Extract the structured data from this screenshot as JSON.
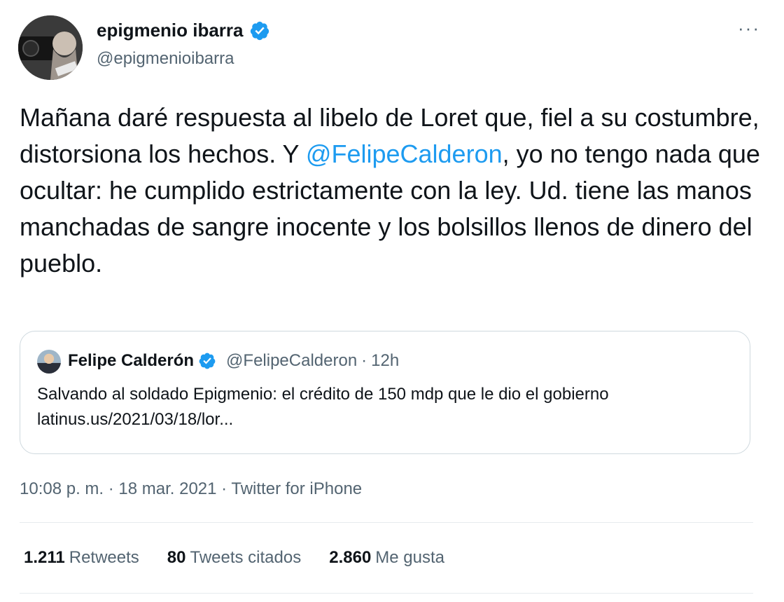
{
  "author": {
    "display_name": "epigmenio ibarra",
    "handle": "@epigmenioibarra",
    "verified_icon": "verified-badge-icon"
  },
  "more_label": "···",
  "tweet": {
    "text_before": "Mañana daré respuesta al libelo de Loret que, fiel a su costumbre, distorsiona los hechos. Y ",
    "mention": "@FelipeCalderon",
    "text_after": ", yo no tengo nada que ocultar: he cumplido estrictamente con la ley. Ud. tiene las manos manchadas de sangre inocente y los bolsillos llenos de dinero del pueblo."
  },
  "quote": {
    "name": "Felipe Calderón",
    "handle": "@FelipeCalderon",
    "separator": "·",
    "time": "12h",
    "text_line1": "Salvando al soldado Epigmenio: el crédito de 150 mdp que le dio el gobierno",
    "text_line2": "latinus.us/2021/03/18/lor..."
  },
  "timestamp": "10:08 p. m. · 18 mar. 2021 · Twitter for iPhone",
  "stats": {
    "retweets_count": "1.211",
    "retweets_label": "Retweets",
    "quotes_count": "80",
    "quotes_label": "Tweets citados",
    "likes_count": "2.860",
    "likes_label": "Me gusta"
  },
  "colors": {
    "accent": "#1d9bf0",
    "secondary_text": "#536471",
    "border": "#cfd9de"
  }
}
